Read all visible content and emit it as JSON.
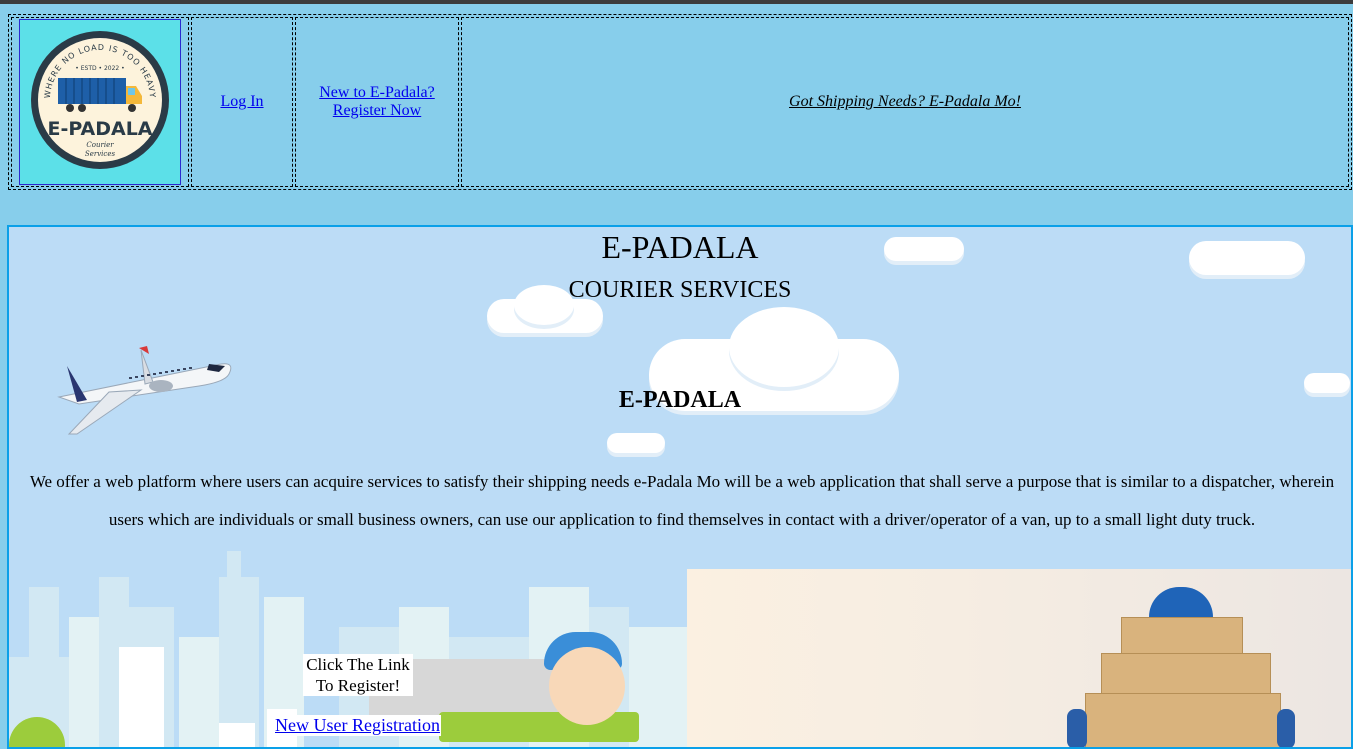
{
  "nav": {
    "logo": {
      "arc_text": "WHERE NO LOAD IS TOO HEAVY",
      "estd": "• ESTD • 2022 •",
      "brand": "E-PADALA",
      "sub1": "Courier",
      "sub2": "Services"
    },
    "login_label": "Log In",
    "register_line1": "New to E-Padala?",
    "register_line2": "Register Now",
    "tagline": "Got Shipping Needs? E-Padala Mo!"
  },
  "hero": {
    "title": "E-PADALA",
    "subtitle": "COURIER SERVICES",
    "heading": "E-PADALA",
    "description": "We offer a web platform where users can acquire services to satisfy their shipping needs e-Padala Mo will be a web application that shall serve a purpose that is similar to a dispatcher, wherein users which are individuals or small business owners, can use our application to find themselves in contact with a driver/operator of a van, up to a small light duty truck.",
    "cta_line1": "Click The Link",
    "cta_line2": "To Register!",
    "registration_link": "New User Registration"
  },
  "colors": {
    "page_bg": "#87ceeb",
    "hero_bg": "#bcdcf6",
    "hero_border": "#0aa0e8",
    "link": "#0000ee",
    "logo_bg": "#5ce0e8"
  }
}
